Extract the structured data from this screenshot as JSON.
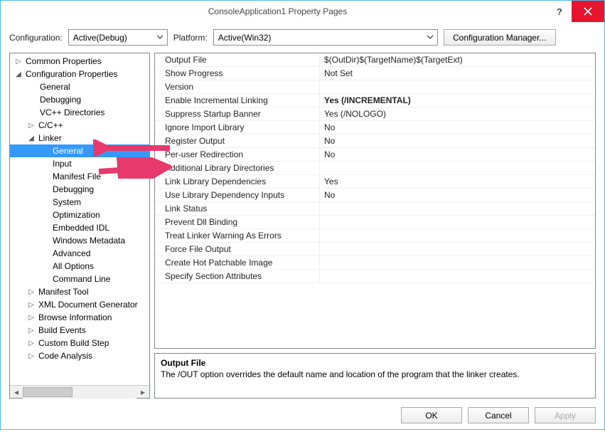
{
  "window": {
    "title": "ConsoleApplication1 Property Pages"
  },
  "toolbar": {
    "cfg_label": "Configuration:",
    "cfg_value": "Active(Debug)",
    "plat_label": "Platform:",
    "plat_value": "Active(Win32)",
    "cfg_mgr": "Configuration Manager..."
  },
  "tree": {
    "n0": "Common Properties",
    "n1": "Configuration Properties",
    "n2": "General",
    "n3": "Debugging",
    "n4": "VC++ Directories",
    "n5": "C/C++",
    "n6": "Linker",
    "n7": "General",
    "n8": "Input",
    "n9": "Manifest File",
    "n10": "Debugging",
    "n11": "System",
    "n12": "Optimization",
    "n13": "Embedded IDL",
    "n14": "Windows Metadata",
    "n15": "Advanced",
    "n16": "All Options",
    "n17": "Command Line",
    "n18": "Manifest Tool",
    "n19": "XML Document Generator",
    "n20": "Browse Information",
    "n21": "Build Events",
    "n22": "Custom Build Step",
    "n23": "Code Analysis"
  },
  "grid": {
    "r0l": "Output File",
    "r0r": "$(OutDir)$(TargetName)$(TargetExt)",
    "r1l": "Show Progress",
    "r1r": "Not Set",
    "r2l": "Version",
    "r2r": "",
    "r3l": "Enable Incremental Linking",
    "r3r": "Yes (/INCREMENTAL)",
    "r4l": "Suppress Startup Banner",
    "r4r": "Yes (/NOLOGO)",
    "r5l": "Ignore Import Library",
    "r5r": "No",
    "r6l": "Register Output",
    "r6r": "No",
    "r7l": "Per-user Redirection",
    "r7r": "No",
    "r8l": "Additional Library Directories",
    "r8r": "",
    "r9l": "Link Library Dependencies",
    "r9r": "Yes",
    "r10l": "Use Library Dependency Inputs",
    "r10r": "No",
    "r11l": "Link Status",
    "r11r": "",
    "r12l": "Prevent Dll Binding",
    "r12r": "",
    "r13l": "Treat Linker Warning As Errors",
    "r13r": "",
    "r14l": "Force File Output",
    "r14r": "",
    "r15l": "Create Hot Patchable Image",
    "r15r": "",
    "r16l": "Specify Section Attributes",
    "r16r": ""
  },
  "desc": {
    "title": "Output File",
    "body": "The /OUT option overrides the default name and location of the program that the linker creates."
  },
  "footer": {
    "ok": "OK",
    "cancel": "Cancel",
    "apply": "Apply"
  }
}
